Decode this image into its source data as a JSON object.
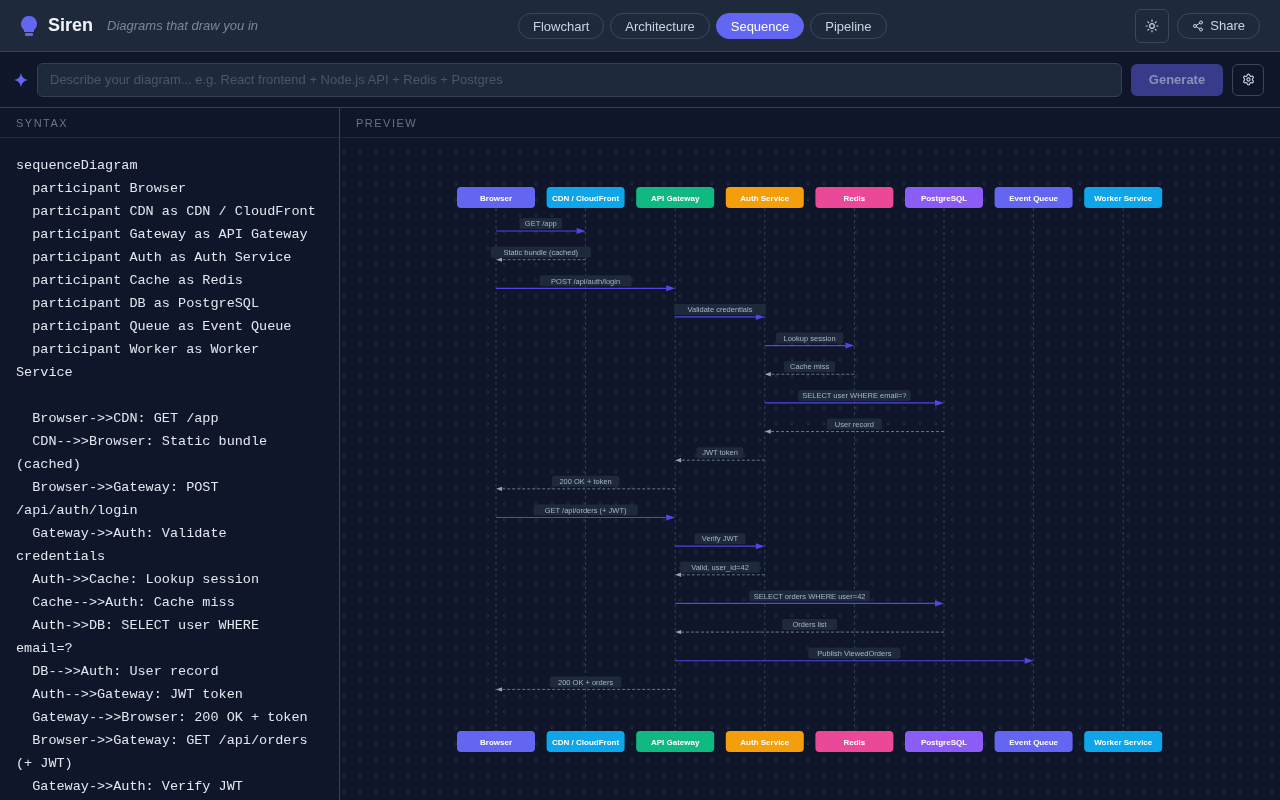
{
  "app": {
    "name": "Siren",
    "tagline": "Diagrams that draw you in"
  },
  "tabs": [
    {
      "label": "Flowchart",
      "selected": false
    },
    {
      "label": "Architecture",
      "selected": false
    },
    {
      "label": "Sequence",
      "selected": true
    },
    {
      "label": "Pipeline",
      "selected": false
    }
  ],
  "share_button": {
    "label": "Share"
  },
  "prompt": {
    "placeholder": "Describe your diagram... e.g. React frontend + Node.js API + Redis + Postgres"
  },
  "generate_button": {
    "label": "Generate",
    "disabled": true
  },
  "syntax_panel": {
    "title": "SYNTAX",
    "code_blocks": [
      [
        "sequenceDiagram",
        "  participant Browser",
        "  participant CDN as CDN / CloudFront",
        "  participant Gateway as API Gateway",
        "  participant Auth as Auth Service",
        "  participant Cache as Redis",
        "  participant DB as PostgreSQL",
        "  participant Queue as Event Queue",
        "  participant Worker as Worker Service"
      ],
      [
        "  Browser->>CDN: GET /app",
        "  CDN-->>Browser: Static bundle (cached)",
        "  Browser->>Gateway: POST /api/auth/login",
        "  Gateway->>Auth: Validate credentials",
        "  Auth->>Cache: Lookup session",
        "  Cache-->>Auth: Cache miss",
        "  Auth->>DB: SELECT user WHERE email=?",
        "  DB-->>Auth: User record",
        "  Auth-->>Gateway: JWT token",
        "  Gateway-->>Browser: 200 OK + token",
        "  Browser->>Gateway: GET /api/orders (+ JWT)",
        "  Gateway->>Auth: Verify JWT"
      ]
    ]
  },
  "preview_panel": {
    "title": "PREVIEW",
    "participants": [
      {
        "name": "Browser",
        "color": "#6366f1"
      },
      {
        "name": "CDN / CloudFront",
        "color": "#0ea5e9"
      },
      {
        "name": "API Gateway",
        "color": "#10b981"
      },
      {
        "name": "Auth Service",
        "color": "#f59e0b"
      },
      {
        "name": "Redis",
        "color": "#ec4899"
      },
      {
        "name": "PostgreSQL",
        "color": "#8b5cf6"
      },
      {
        "name": "Event Queue",
        "color": "#6366f1"
      },
      {
        "name": "Worker Service",
        "color": "#0ea5e9"
      }
    ],
    "messages": [
      {
        "label": "GET /app",
        "kind": "sync"
      },
      {
        "label": "Static bundle (cached)",
        "kind": "reply"
      },
      {
        "label": "POST /api/auth/login",
        "kind": "sync"
      },
      {
        "label": "Validate credentials",
        "kind": "sync"
      },
      {
        "label": "Lookup session",
        "kind": "sync"
      },
      {
        "label": "Cache miss",
        "kind": "reply"
      },
      {
        "label": "SELECT user WHERE email=?",
        "kind": "sync"
      },
      {
        "label": "User record",
        "kind": "reply"
      },
      {
        "label": "JWT token",
        "kind": "reply"
      },
      {
        "label": "200 OK + token",
        "kind": "reply"
      },
      {
        "label": "GET /api/orders (+ JWT)",
        "kind": "sync"
      },
      {
        "label": "Verify JWT",
        "kind": "sync"
      },
      {
        "label": "Valid, user_id=42",
        "kind": "reply"
      },
      {
        "label": "SELECT orders WHERE user=42",
        "kind": "sync"
      },
      {
        "label": "Orders list",
        "kind": "reply"
      },
      {
        "label": "Publish ViewedOrders",
        "kind": "sync"
      },
      {
        "label": "200 OK + orders",
        "kind": "reply"
      }
    ],
    "footer_participants": [
      {
        "name": "Browser",
        "color": "#6366f1"
      },
      {
        "name": "CDN / CloudFront",
        "color": "#0ea5e9"
      },
      {
        "name": "API Gateway",
        "color": "#10b981"
      },
      {
        "name": "Auth Service",
        "color": "#f59e0b"
      },
      {
        "name": "Redis",
        "color": "#ec4899"
      },
      {
        "name": "PostgreSQL",
        "color": "#8b5cf6"
      },
      {
        "name": "Event Queue",
        "color": "#6366f1"
      },
      {
        "name": "Worker Service",
        "color": "#0ea5e9"
      }
    ]
  }
}
